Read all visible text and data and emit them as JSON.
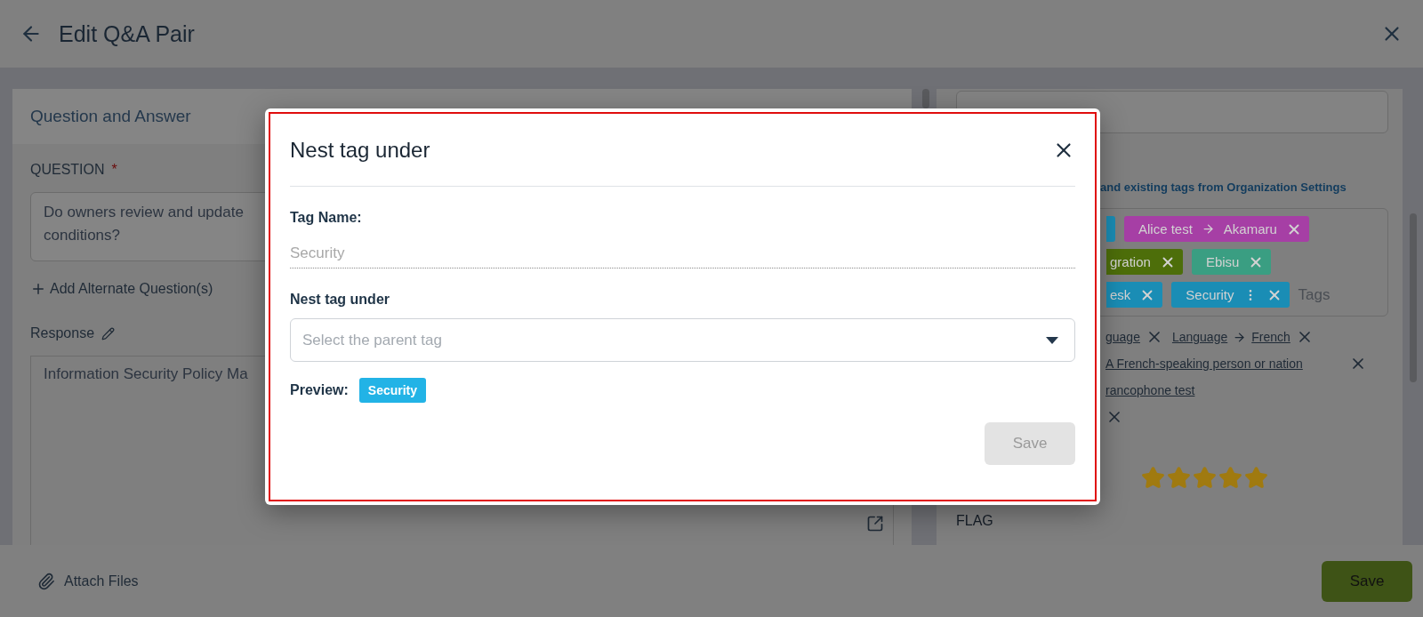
{
  "header": {
    "title": "Edit Q&A Pair"
  },
  "question_card": {
    "title": "Question and Answer",
    "question_label": "QUESTION",
    "required_mark": "*",
    "question_lines": [
      "Do owners review and update",
      "conditions?"
    ],
    "add_alternate": "Add Alternate Question(s)",
    "response_label": "Response",
    "response_text": "Information Security Policy Ma"
  },
  "side_panel": {
    "tags_hint": "and existing tags from Organization Settings",
    "tag_rows": [
      [
        {
          "kind": "stub",
          "color": "#1a8db5"
        },
        {
          "kind": "chip",
          "label": "Alice test",
          "child": "Akamaru",
          "color": "#a63fa5"
        }
      ],
      [
        {
          "kind": "chip",
          "label": "gration",
          "cut": true,
          "color": "#4d6e0a"
        },
        {
          "kind": "chip",
          "label": "Ebisu",
          "color": "#3a9e82"
        }
      ],
      [
        {
          "kind": "chip",
          "label": "esk",
          "cut": true,
          "color": "#1a8db5"
        },
        {
          "kind": "chip",
          "label": "Security",
          "menu": true,
          "color": "#1a8db5"
        }
      ]
    ],
    "tags_placeholder": "Tags",
    "link_lines": [
      {
        "items": [
          {
            "parts": [
              "guage"
            ],
            "removable": true
          },
          {
            "parts": [
              "Language",
              "French"
            ],
            "removable": true
          }
        ]
      },
      {
        "items": [
          {
            "parts": [
              "A French-speaking person or nation"
            ],
            "removable": true,
            "far": true
          }
        ]
      },
      {
        "items": [
          {
            "parts": [
              "rancophone test"
            ],
            "removable": false
          }
        ]
      },
      {
        "items": [
          {
            "removable": true
          }
        ]
      }
    ],
    "stars": 5,
    "flag_label": "FLAG"
  },
  "footer": {
    "attach": "Attach Files",
    "save": "Save"
  },
  "dialog": {
    "title": "Nest tag under",
    "tag_name_label": "Tag Name:",
    "tag_name_placeholder": "Security",
    "parent_label": "Nest tag under",
    "parent_placeholder": "Select the parent tag",
    "preview_label": "Preview:",
    "preview_tag": "Security",
    "save": "Save",
    "save_disabled": true
  }
}
